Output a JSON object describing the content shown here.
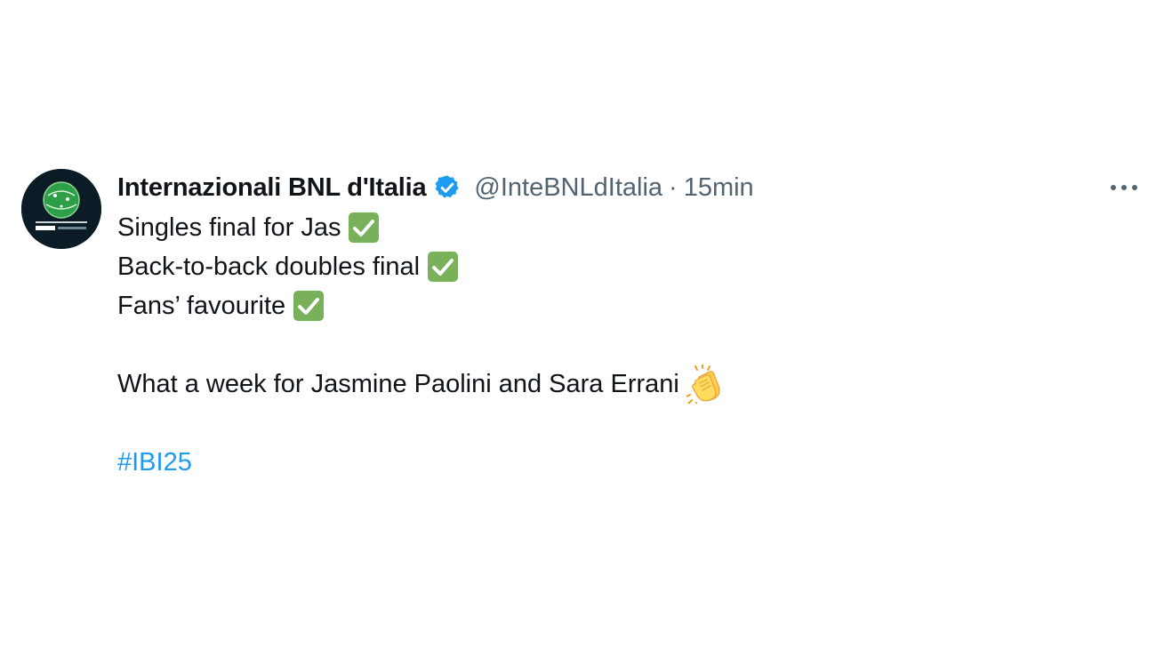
{
  "author": {
    "display_name": "Internazionali BNL d'Italia",
    "handle": "@InteBNLdItalia",
    "separator": "·",
    "timestamp": "15min",
    "verified_icon": "verified-badge-icon"
  },
  "tweet": {
    "lines": [
      {
        "text": "Singles final for Jas",
        "icon": "check-mark-icon"
      },
      {
        "text": "Back-to-back doubles final",
        "icon": "check-mark-icon"
      },
      {
        "text": "Fans’ favourite",
        "icon": "check-mark-icon"
      }
    ],
    "closing_line": {
      "text": "What a week for Jasmine Paolini and Sara Errani",
      "icon": "clapping-hands-icon"
    },
    "hashtag": "#IBI25"
  },
  "colors": {
    "text": "#0f1419",
    "muted": "#536471",
    "link": "#1d9bf0",
    "verified": "#1d9bf0",
    "check_bg": "#78b159"
  }
}
